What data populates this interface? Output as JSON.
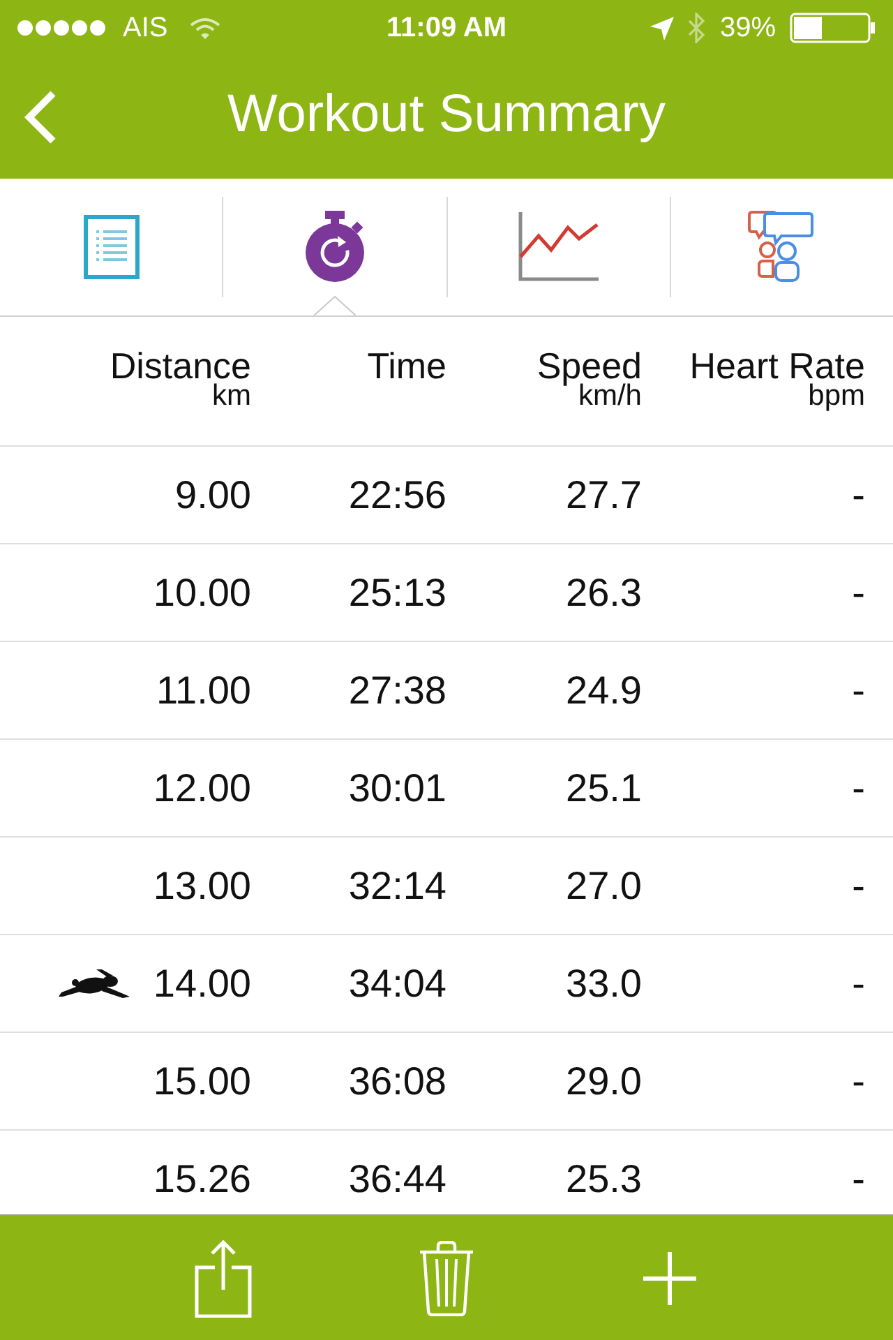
{
  "status_bar": {
    "carrier": "AIS",
    "time": "11:09 AM",
    "battery": "39%"
  },
  "nav_bar": {
    "title": "Workout Summary"
  },
  "tabs": [
    {
      "kind": "list",
      "selected": false
    },
    {
      "kind": "laps",
      "selected": true
    },
    {
      "kind": "chart",
      "selected": false
    },
    {
      "kind": "social",
      "selected": false
    }
  ],
  "table": {
    "columns": [
      {
        "label": "Distance",
        "unit": "km"
      },
      {
        "label": "Time"
      },
      {
        "label": "Speed",
        "unit": "km/h"
      },
      {
        "label": "Heart Rate",
        "unit": "bpm"
      }
    ],
    "rows": [
      {
        "cells": [
          "9.00",
          "22:56",
          "27.7",
          "-"
        ],
        "fastest": false
      },
      {
        "cells": [
          "10.00",
          "25:13",
          "26.3",
          "-"
        ],
        "fastest": false
      },
      {
        "cells": [
          "11.00",
          "27:38",
          "24.9",
          "-"
        ],
        "fastest": false
      },
      {
        "cells": [
          "12.00",
          "30:01",
          "25.1",
          "-"
        ],
        "fastest": false
      },
      {
        "cells": [
          "13.00",
          "32:14",
          "27.0",
          "-"
        ],
        "fastest": false
      },
      {
        "cells": [
          "14.00",
          "34:04",
          "33.0",
          "-"
        ],
        "fastest": true
      },
      {
        "cells": [
          "15.00",
          "36:08",
          "29.0",
          "-"
        ],
        "fastest": false
      },
      {
        "cells": [
          "15.26",
          "36:44",
          "25.3",
          "-"
        ],
        "fastest": false
      }
    ]
  },
  "toolbar": {
    "buttons": [
      {
        "kind": "share"
      },
      {
        "kind": "delete"
      },
      {
        "kind": "add"
      }
    ]
  }
}
